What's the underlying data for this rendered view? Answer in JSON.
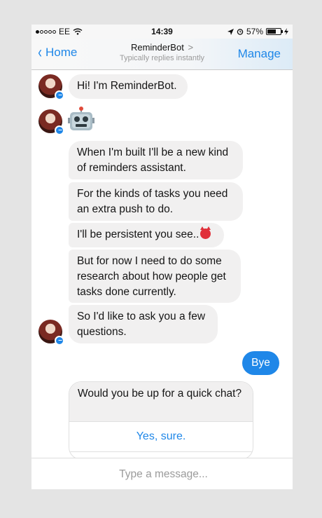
{
  "status_bar": {
    "carrier": "EE",
    "time": "14:39",
    "battery": "57%"
  },
  "nav": {
    "back_label": "Home",
    "title": "ReminderBot",
    "title_arrow": ">",
    "subtitle": "Typically replies instantly",
    "manage_label": "Manage"
  },
  "messages": {
    "m1": "Hi! I'm ReminderBot.",
    "m2": "When I'm built I'll be a new kind of reminders assistant.",
    "m3": "For the kinds of tasks you need an extra push to do.",
    "m4": "I'll be persistent you see..",
    "m5": "But for now I need to do some research about how people get tasks done currently.",
    "m6": "So I'd like to ask you a few questions.",
    "user_reply": "Bye",
    "question": "Would you be up for a quick chat?",
    "option_1": "Yes, sure."
  },
  "composer": {
    "placeholder": "Type a message..."
  },
  "colors": {
    "accent": "#1f87e8",
    "bubble_bg": "#f1f0f0"
  },
  "icons": [
    "signal-dots-icon",
    "wifi-icon",
    "location-arrow-icon",
    "alarm-icon",
    "battery-icon",
    "charging-bolt-icon",
    "back-chevron-icon",
    "robot-emoji-icon",
    "devil-emoji-icon",
    "messenger-badge-icon"
  ]
}
